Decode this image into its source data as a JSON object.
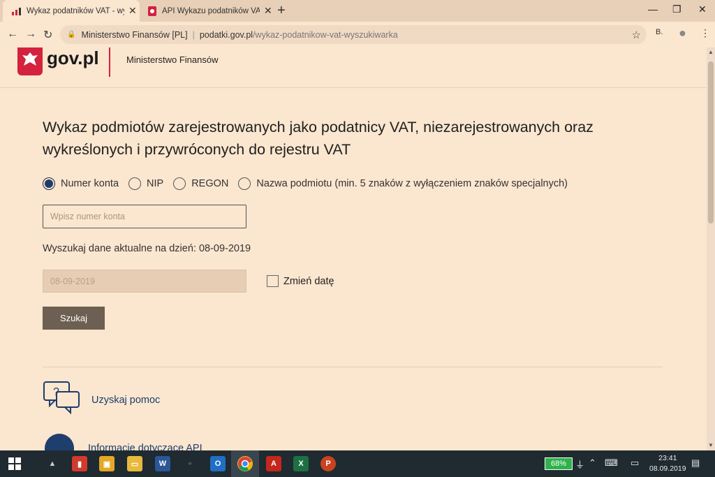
{
  "browser": {
    "tabs": [
      {
        "title": "Wykaz podatników VAT - wyszuk",
        "active": true
      },
      {
        "title": "API Wykazu podatników VAT - Kı",
        "active": false
      }
    ],
    "address": {
      "site_name": "Ministerstwo Finansów [PL]",
      "domain": "podatki.gov.pl",
      "path": "/wykaz-podatnikow-vat-wyszukiwarka"
    }
  },
  "header": {
    "brand": "gov.pl",
    "ministry": "Ministerstwo Finansów"
  },
  "main": {
    "title": "Wykaz podmiotów zarejestrowanych jako podatnicy VAT, niezarejestrowanych oraz wykreślonych i przywróconych do rejestru VAT",
    "search_types": [
      {
        "label": "Numer konta",
        "selected": true
      },
      {
        "label": "NIP",
        "selected": false
      },
      {
        "label": "REGON",
        "selected": false
      },
      {
        "label": "Nazwa podmiotu (min. 5 znaków z wyłączeniem znaków specjalnych)",
        "selected": false
      }
    ],
    "account_placeholder": "Wpisz numer konta",
    "date_label": "Wyszukaj dane aktualne na dzień: 08-09-2019",
    "date_placeholder": "08-09-2019",
    "change_date_label": "Zmień datę",
    "search_button": "Szukaj",
    "help_link": "Uzyskaj pomoc",
    "api_link": "Informacje dotyczące API"
  },
  "taskbar": {
    "battery": "68%",
    "time": "23:41",
    "date": "08.09.2019"
  }
}
